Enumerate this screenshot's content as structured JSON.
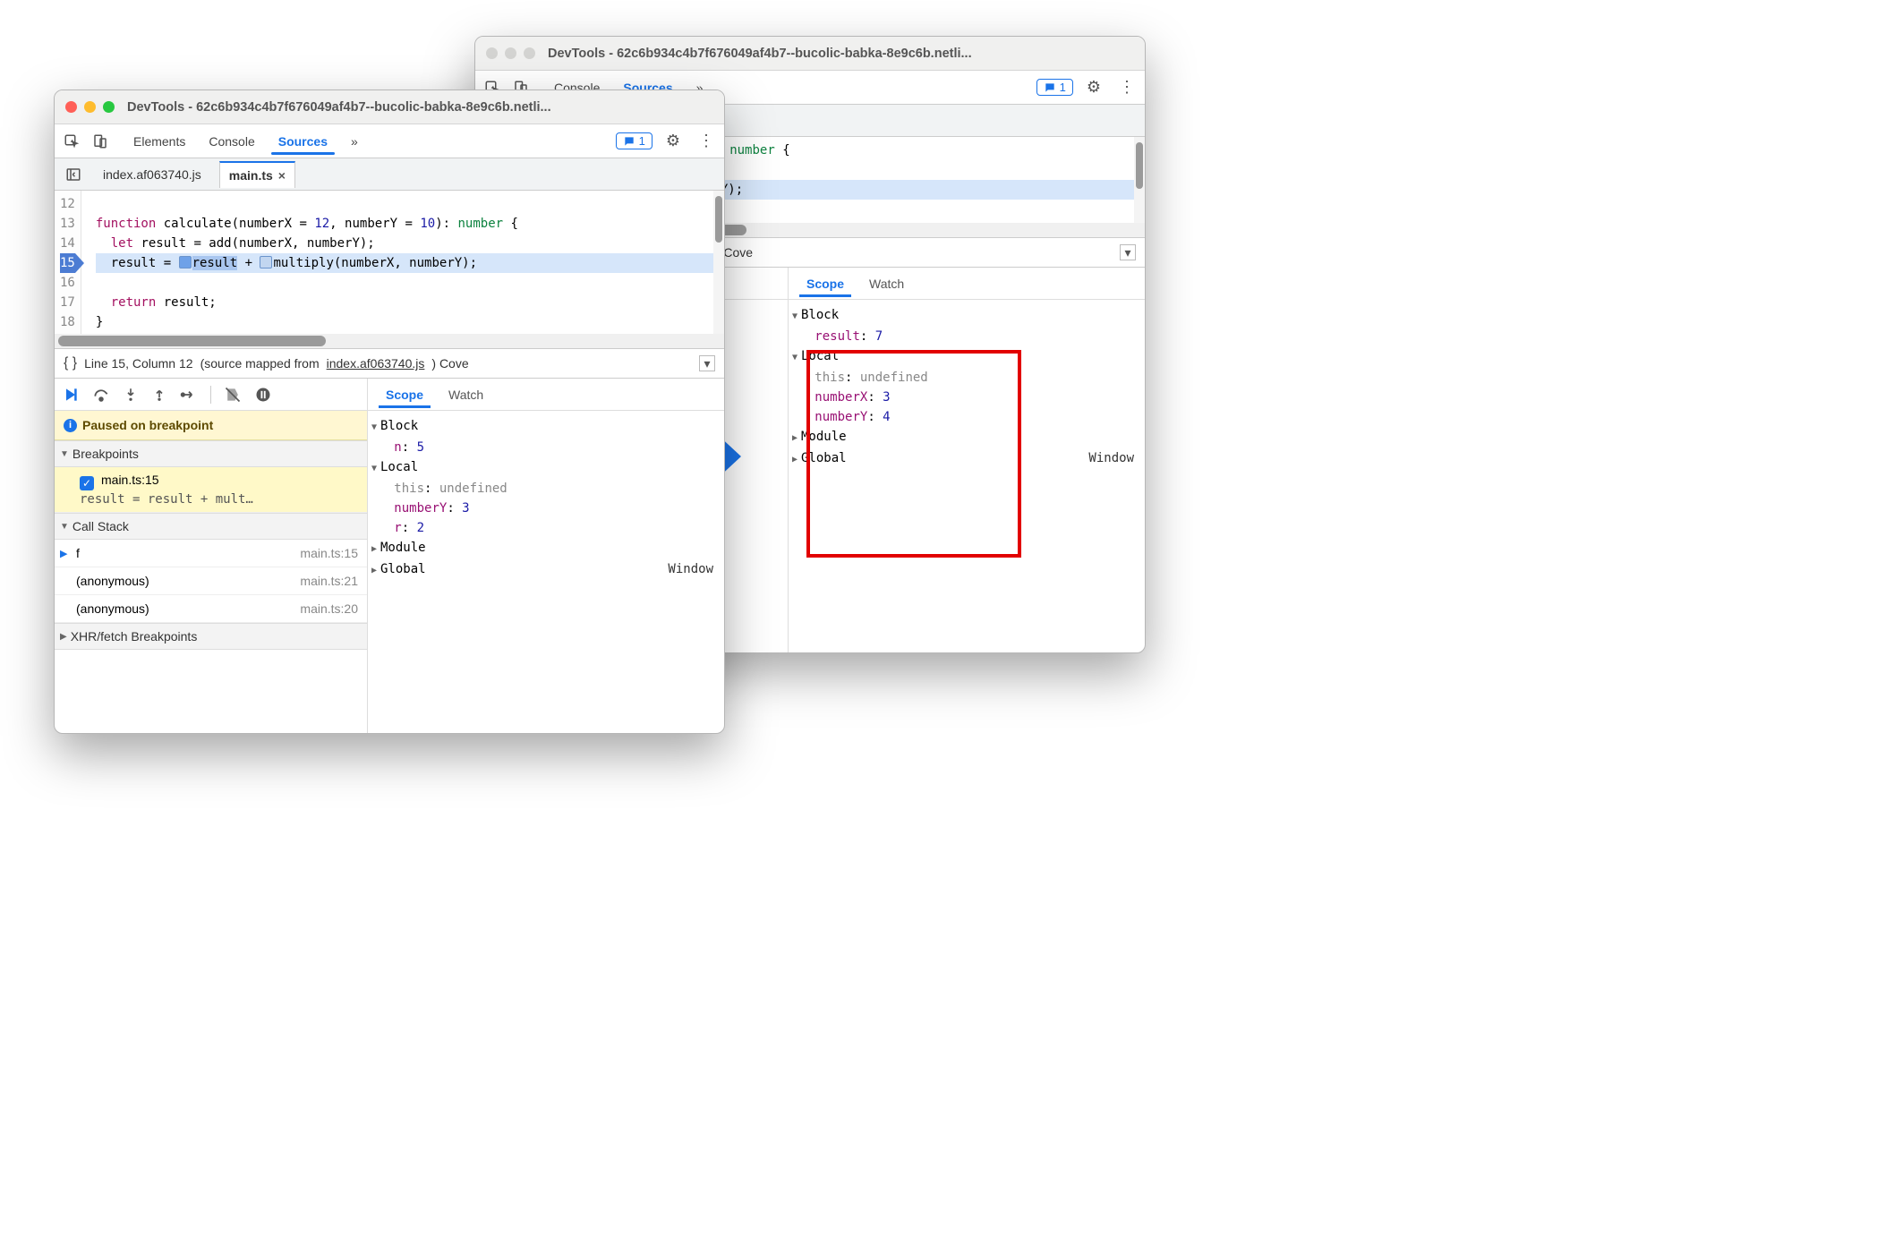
{
  "colors": {
    "traffic_red": "#ff5f57",
    "traffic_yellow": "#febc2e",
    "traffic_green": "#28c840",
    "traffic_inactive": "#d3d3d1",
    "accent": "#1a73e8"
  },
  "back": {
    "title": "DevTools - 62c6b934c4b7f676049af4b7--bucolic-babka-8e9c6b.netli...",
    "toolbar": {
      "tabs": [
        "Console",
        "Sources"
      ],
      "active": "Sources",
      "more": "»",
      "msg_count": "1"
    },
    "files": {
      "tabs": [
        "3740.js",
        "main.ts"
      ],
      "active": "main.ts"
    },
    "code": {
      "lines": [
        {
          "t": "ate(numberX = 12, numberY = 10): number {"
        },
        {
          "t": "add(numberX, numberY);"
        },
        {
          "t": "ult + Dmultiply(numberX, numberY);",
          "exec": true
        }
      ]
    },
    "status": {
      "mapped_prefix": "(source mapped from ",
      "mapped_file": "index.af063740.js",
      "mapped_suffix": ") Cove"
    },
    "scope": {
      "tabs": [
        "Scope",
        "Watch"
      ],
      "active": "Scope",
      "tree": [
        {
          "type": "group",
          "label": "Block",
          "open": true,
          "children": [
            {
              "prop": "result",
              "val": "7",
              "blue": true
            }
          ]
        },
        {
          "type": "group",
          "label": "Local",
          "open": true,
          "children": [
            {
              "prop": "this",
              "val": "undefined",
              "grey": true
            },
            {
              "prop": "numberX",
              "val": "3",
              "blue": true
            },
            {
              "prop": "numberY",
              "val": "4",
              "blue": true
            }
          ]
        },
        {
          "type": "group",
          "label": "Module",
          "open": false
        },
        {
          "type": "group",
          "label": "Global",
          "open": false,
          "rhs": "Window"
        }
      ]
    },
    "peek": {
      "mult": "mult…",
      "cs": [
        "in.ts:15",
        "in.ts:21",
        "in.ts:20"
      ]
    }
  },
  "front": {
    "title": "DevTools - 62c6b934c4b7f676049af4b7--bucolic-babka-8e9c6b.netli...",
    "toolbar": {
      "tabs": [
        "Elements",
        "Console",
        "Sources"
      ],
      "active": "Sources",
      "more": "»",
      "msg_count": "1"
    },
    "files": {
      "tabs": [
        "index.af063740.js",
        "main.ts"
      ],
      "active": "main.ts"
    },
    "code": {
      "start": 12,
      "lines": [
        {
          "n": 12,
          "t": ""
        },
        {
          "n": 13,
          "t": "function calculate(numberX = 12, numberY = 10): number {"
        },
        {
          "n": 14,
          "t": "  let result = add(numberX, numberY);"
        },
        {
          "n": 15,
          "t": "  result = result + multiply(numberX, numberY);",
          "exec": true,
          "bp": true
        },
        {
          "n": 16,
          "t": ""
        },
        {
          "n": 17,
          "t": "  return result;"
        },
        {
          "n": 18,
          "t": "}"
        }
      ]
    },
    "status": {
      "line": "Line 15, Column 12",
      "mapped_prefix": "(source mapped from ",
      "mapped_file": "index.af063740.js",
      "mapped_suffix": ") Cove"
    },
    "paused": "Paused on breakpoint",
    "sections": {
      "breakpoints": {
        "label": "Breakpoints",
        "items": [
          {
            "file": "main.ts:15",
            "snip": "result = result + mult…"
          }
        ]
      },
      "callstack": {
        "label": "Call Stack",
        "items": [
          {
            "fn": "f",
            "loc": "main.ts:15",
            "curr": true
          },
          {
            "fn": "(anonymous)",
            "loc": "main.ts:21"
          },
          {
            "fn": "(anonymous)",
            "loc": "main.ts:20"
          }
        ]
      },
      "xhr": {
        "label": "XHR/fetch Breakpoints"
      }
    },
    "scope": {
      "tabs": [
        "Scope",
        "Watch"
      ],
      "active": "Scope",
      "tree": [
        {
          "type": "group",
          "label": "Block",
          "open": true,
          "children": [
            {
              "prop": "n",
              "val": "5",
              "blue": true
            }
          ]
        },
        {
          "type": "group",
          "label": "Local",
          "open": true,
          "children": [
            {
              "prop": "this",
              "val": "undefined",
              "grey": true
            },
            {
              "prop": "numberY",
              "val": "3",
              "blue": true
            },
            {
              "prop": "r",
              "val": "2",
              "blue": true
            }
          ]
        },
        {
          "type": "group",
          "label": "Module",
          "open": false
        },
        {
          "type": "group",
          "label": "Global",
          "open": false,
          "rhs": "Window"
        }
      ]
    }
  }
}
